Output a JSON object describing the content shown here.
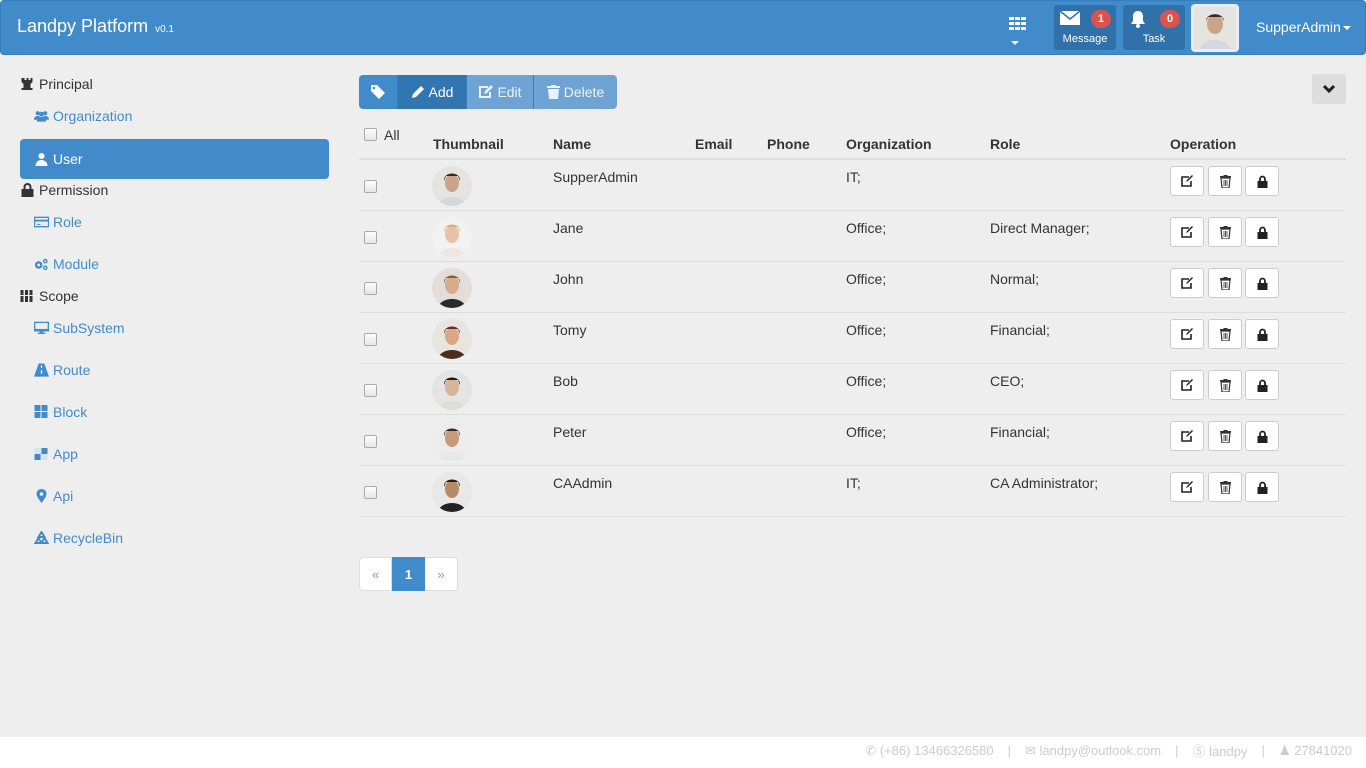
{
  "header": {
    "brand": "Landpy Platform",
    "version": "v0.1",
    "message": {
      "label": "Message",
      "count": "1"
    },
    "task": {
      "label": "Task",
      "count": "0"
    },
    "user": "SupperAdmin"
  },
  "sidebar": {
    "groups": [
      {
        "label": "Principal",
        "icon": "chess-rook-icon",
        "items": [
          {
            "label": "Organization",
            "icon": "users-icon"
          },
          {
            "label": "User",
            "icon": "user-icon",
            "active": true
          }
        ]
      },
      {
        "label": "Permission",
        "icon": "lock-icon",
        "items": [
          {
            "label": "Role",
            "icon": "credit-card-icon"
          },
          {
            "label": "Module",
            "icon": "cogs-icon"
          }
        ]
      },
      {
        "label": "Scope",
        "icon": "columns-icon",
        "items": [
          {
            "label": "SubSystem",
            "icon": "desktop-icon"
          },
          {
            "label": "Route",
            "icon": "road-icon"
          },
          {
            "label": "Block",
            "icon": "th-large-icon"
          },
          {
            "label": "App",
            "icon": "app-icon"
          },
          {
            "label": "Api",
            "icon": "map-marker-icon"
          },
          {
            "label": "RecycleBin",
            "icon": "recycle-icon"
          }
        ]
      }
    ]
  },
  "toolbar": {
    "add": "Add",
    "edit": "Edit",
    "delete": "Delete"
  },
  "table": {
    "select_all": "All",
    "columns": [
      "Thumbnail",
      "Name",
      "Email",
      "Phone",
      "Organization",
      "Role",
      "Operation"
    ],
    "rows": [
      {
        "name": "SupperAdmin",
        "email": "",
        "phone": "",
        "organization": "IT;",
        "role": ""
      },
      {
        "name": "Jane",
        "email": "",
        "phone": "",
        "organization": "Office;",
        "role": "Direct Manager;"
      },
      {
        "name": "John",
        "email": "",
        "phone": "",
        "organization": "Office;",
        "role": "Normal;"
      },
      {
        "name": "Tomy",
        "email": "",
        "phone": "",
        "organization": "Office;",
        "role": "Financial;"
      },
      {
        "name": "Bob",
        "email": "",
        "phone": "",
        "organization": "Office;",
        "role": "CEO;"
      },
      {
        "name": "Peter",
        "email": "",
        "phone": "",
        "organization": "Office;",
        "role": "Financial;"
      },
      {
        "name": "CAAdmin",
        "email": "",
        "phone": "",
        "organization": "IT;",
        "role": "CA Administrator;"
      }
    ]
  },
  "pagination": {
    "prev": "«",
    "current": "1",
    "next": "»"
  },
  "footer": {
    "phone": "(+86) 13466326580",
    "email": "landpy@outlook.com",
    "skype": "landpy",
    "qq": "27841020"
  }
}
